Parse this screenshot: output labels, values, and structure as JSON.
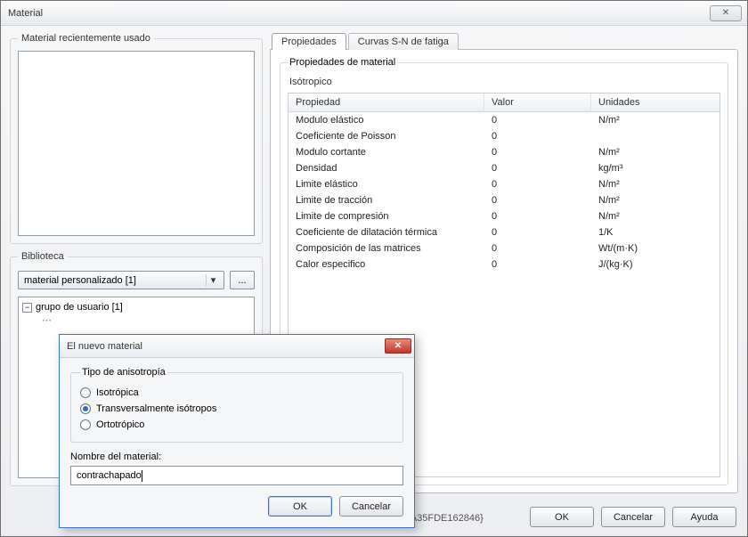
{
  "window": {
    "title": "Material",
    "close_glyph": "✕"
  },
  "left": {
    "recent_title": "Material recientemente usado",
    "library_title": "Biblioteca",
    "combo_value": "material personalizado [1]",
    "dots_label": "...",
    "tree_root": "grupo de usuario [1]"
  },
  "tabs": {
    "props": "Propiedades",
    "sn": "Curvas S-N de fatiga"
  },
  "props_panel": {
    "group_title": "Propiedades de material",
    "subtype": "Isótropico",
    "headers": {
      "prop": "Propiedad",
      "val": "Valor",
      "unit": "Unidades"
    },
    "rows": [
      {
        "prop": "Modulo elástico",
        "val": "0",
        "unit": "N/m²"
      },
      {
        "prop": "Coeficiente de Poisson",
        "val": "0",
        "unit": ""
      },
      {
        "prop": "Modulo cortante",
        "val": "0",
        "unit": "N/m²"
      },
      {
        "prop": "Densidad",
        "val": "0",
        "unit": "kg/m³"
      },
      {
        "prop": "Limite elástico",
        "val": "0",
        "unit": "N/m²"
      },
      {
        "prop": "Limite de tracción",
        "val": "0",
        "unit": "N/m²"
      },
      {
        "prop": "Limite de compresión",
        "val": "0",
        "unit": "N/m²"
      },
      {
        "prop": "Coeficiente de dilatación térmica",
        "val": "0",
        "unit": "1/K"
      },
      {
        "prop": "Composición de las matrices",
        "val": "0",
        "unit": "Wt/(m·K)"
      },
      {
        "prop": "Calor especifico",
        "val": "0",
        "unit": "J/(kg·K)"
      }
    ]
  },
  "guid": "{512CB4AB-63EE-4776-8E18-A35FDE162846}",
  "buttons": {
    "ok": "OK",
    "cancel": "Cancelar",
    "help": "Ayuda"
  },
  "modal": {
    "title": "El nuevo material",
    "aniso_title": "Tipo de anisotropía",
    "opt_iso": "Isotrópica",
    "opt_trans": "Transversalmente isótropos",
    "opt_orto": "Ortotrópico",
    "name_label": "Nombre del material:",
    "name_value": "contrachapado",
    "ok": "OK",
    "cancel": "Cancelar",
    "close_glyph": "✕"
  }
}
